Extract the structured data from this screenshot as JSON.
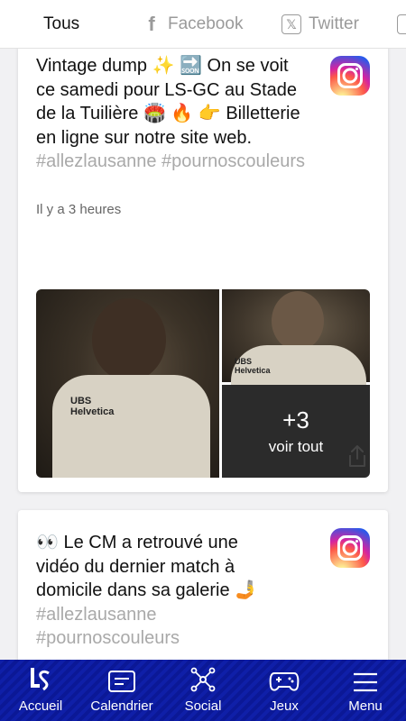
{
  "filters": {
    "all": "Tous",
    "facebook": "Facebook",
    "twitter": "Twitter"
  },
  "posts": [
    {
      "source_icon": "instagram-icon",
      "text_main": "Vintage dump ✨ 🔜 On se voit ce samedi pour LS-GC au Stade de la Tuilière 🏟️ 🔥 👉 Billetterie en ligne sur notre site web.",
      "tags": "#allezlausanne #pournoscouleurs",
      "time": "Il y a 3 heures",
      "more_count": "+3",
      "more_label": "voir tout"
    },
    {
      "source_icon": "instagram-icon",
      "text_main": "👀 Le CM a retrouvé une vidéo du dernier match à domicile dans sa galerie 🤳",
      "tags": "#allezlausanne #pournoscouleurs"
    }
  ],
  "nav": [
    {
      "label": "Accueil",
      "icon": "logo-ls-icon"
    },
    {
      "label": "Calendrier",
      "icon": "calendar-icon"
    },
    {
      "label": "Social",
      "icon": "network-icon"
    },
    {
      "label": "Jeux",
      "icon": "gamepad-icon"
    },
    {
      "label": "Menu",
      "icon": "hamburger-icon"
    }
  ],
  "colors": {
    "nav_bg": "#0f1fa8",
    "tag_grey": "#a9a9a9",
    "inactive_tab": "#9a9a9a"
  }
}
